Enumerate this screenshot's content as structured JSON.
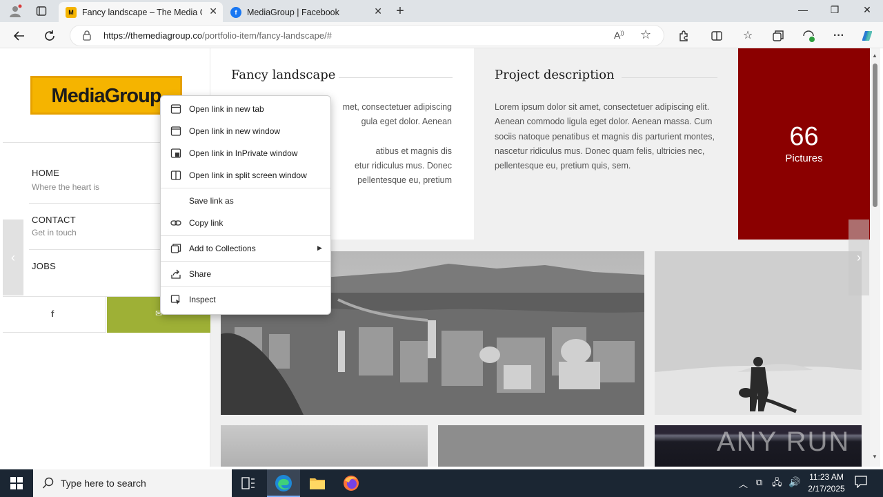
{
  "browser": {
    "tabs": [
      {
        "title": "Fancy landscape – The Media Group",
        "active": true,
        "favicon": "mediagroup-favicon"
      },
      {
        "title": "MediaGroup | Facebook",
        "active": false,
        "favicon": "facebook-favicon"
      }
    ],
    "url_host": "https://themediagroup.co",
    "url_path": "/portfolio-item/fancy-landscape/#"
  },
  "sidebar": {
    "logo_text": "MediaGroup",
    "nav": [
      {
        "title": "HOME",
        "subtitle": "Where the heart is"
      },
      {
        "title": "CONTACT",
        "subtitle": "Get in touch"
      },
      {
        "title": "JOBS",
        "subtitle": ""
      }
    ],
    "social": [
      "facebook-icon",
      "email-icon"
    ]
  },
  "content": {
    "title": "Fancy landscape",
    "title_para_visible": "met, consectetuer adipiscing\ngula eget dolor. Aenean\n\natibus et magnis dis\netur ridiculus mus. Donec\npellentesque eu, pretium",
    "project_heading": "Project description",
    "project_description": "Lorem ipsum dolor sit amet, consectetuer adipiscing elit. Aenean commodo ligula eget dolor. Aenean massa. Cum sociis natoque penatibus et magnis dis parturient montes, nascetur ridiculus mus. Donec quam felis, ultricies nec, pellentesque eu, pretium quis, sem.",
    "counter_number": "66",
    "counter_label": "Pictures",
    "watermark": "ANY RUN"
  },
  "context_menu": {
    "items": [
      {
        "label": "Open link in new tab",
        "icon": "new-tab-icon"
      },
      {
        "label": "Open link in new window",
        "icon": "new-window-icon"
      },
      {
        "label": "Open link in InPrivate window",
        "icon": "inprivate-icon"
      },
      {
        "label": "Open link in split screen window",
        "icon": "split-screen-icon"
      },
      {
        "label": "Save link as",
        "icon": ""
      },
      {
        "label": "Copy link",
        "icon": "link-icon"
      },
      {
        "label": "Add to Collections",
        "icon": "collections-icon",
        "submenu": true
      },
      {
        "label": "Share",
        "icon": "share-icon"
      },
      {
        "label": "Inspect",
        "icon": "inspect-icon"
      }
    ]
  },
  "taskbar": {
    "search_placeholder": "Type here to search",
    "time": "11:23 AM",
    "date": "2/17/2025"
  },
  "colors": {
    "brand_yellow": "#f5b400",
    "counter_red": "#8b0000",
    "social_green": "#9eb036",
    "taskbar_bg": "#1b2633"
  }
}
